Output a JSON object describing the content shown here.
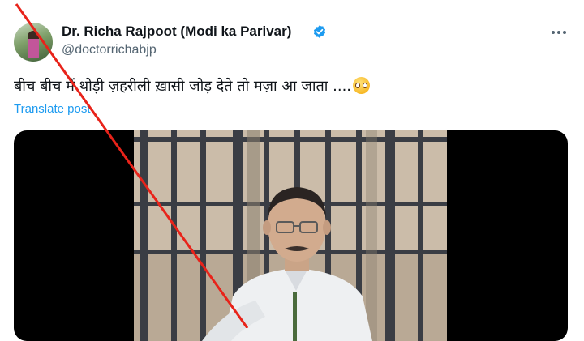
{
  "post": {
    "author_name": "Dr. Richa Rajpoot (Modi ka Parivar)",
    "handle": "@doctorrichabjp",
    "text": "बीच बीच में थोड़ी ज़हरीली ख़ासी जोड़ देते तो मज़ा आ जाता ....",
    "emoji_icon": "pleading-face-emoji",
    "translate_label": "Translate post"
  },
  "colors": {
    "accent": "#1d9bf0",
    "secondary_text": "#536471",
    "strike_line": "#e8231a"
  }
}
